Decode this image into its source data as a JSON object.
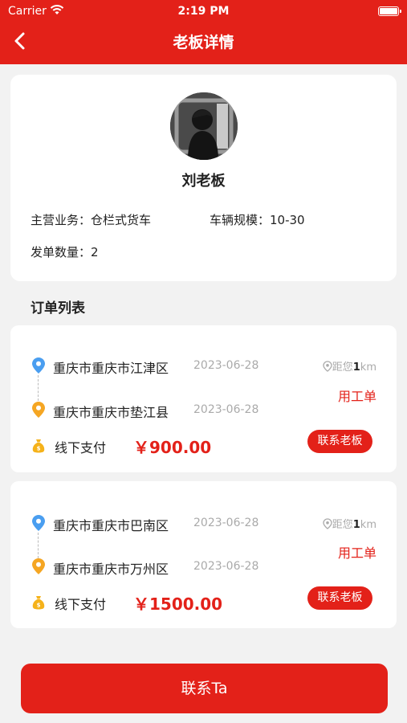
{
  "status_bar": {
    "carrier": "Carrier",
    "time": "2:19 PM"
  },
  "nav": {
    "title": "老板详情"
  },
  "profile": {
    "name": "刘老板",
    "business_label": "主营业务：",
    "business_value": "仓栏式货车",
    "scale_label": "车辆规模：",
    "scale_value": "10-30",
    "count_label": "发单数量：",
    "count_value": "2"
  },
  "orders_section": {
    "title": "订单列表"
  },
  "orders": [
    {
      "from": "重庆市重庆市江津区",
      "from_date": "2023-06-28",
      "to": "重庆市重庆市垫江县",
      "to_date": "2023-06-28",
      "distance_prefix": "距您",
      "distance_value": "1",
      "distance_unit": "km",
      "type": "用工单",
      "pay_type": "线下支付",
      "price": "￥900.00",
      "contact_label": "联系老板"
    },
    {
      "from": "重庆市重庆市巴南区",
      "from_date": "2023-06-28",
      "to": "重庆市重庆市万州区",
      "to_date": "2023-06-28",
      "distance_prefix": "距您",
      "distance_value": "1",
      "distance_unit": "km",
      "type": "用工单",
      "pay_type": "线下支付",
      "price": "￥1500.00",
      "contact_label": "联系老板"
    }
  ],
  "footer": {
    "contact_label": "联系Ta"
  },
  "colors": {
    "brand_red": "#e32119",
    "origin_pin": "#4a9ef0",
    "destination_pin": "#f5a623",
    "money_bag": "#f5b21a"
  },
  "icons": [
    "back-arrow-icon",
    "wifi-icon",
    "battery-icon",
    "location-pin-icon",
    "distance-pin-icon",
    "money-bag-icon"
  ]
}
